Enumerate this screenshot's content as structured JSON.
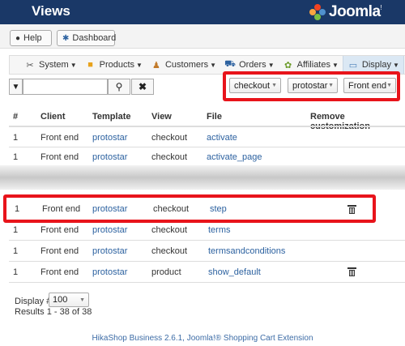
{
  "header": {
    "title": "Views",
    "brand": "Joomla!",
    "brand_word": "Joomla",
    "brand_mark": "!"
  },
  "toolbar": {
    "help_label": "Help",
    "dashboard_label": "Dashboard"
  },
  "menu": {
    "items": [
      {
        "label": "System",
        "icon": "wrench-icon"
      },
      {
        "label": "Products",
        "icon": "box-icon"
      },
      {
        "label": "Customers",
        "icon": "users-icon"
      },
      {
        "label": "Orders",
        "icon": "cart-icon"
      },
      {
        "label": "Affiliates",
        "icon": "affiliates-icon"
      },
      {
        "label": "Display",
        "icon": "display-icon"
      }
    ],
    "active": "Display"
  },
  "filters": {
    "search_value": "",
    "view_select": "checkout",
    "template_select": "protostar",
    "client_select": "Front end"
  },
  "table": {
    "columns": [
      "#",
      "Client",
      "Template",
      "View",
      "File",
      "Remove customization"
    ],
    "rows": [
      {
        "num": "1",
        "client": "Front end",
        "template": "protostar",
        "view": "checkout",
        "file": "activate",
        "removable": false
      },
      {
        "num": "1",
        "client": "Front end",
        "template": "protostar",
        "view": "checkout",
        "file": "activate_page",
        "removable": false
      },
      {
        "num": "1",
        "client": "Front end",
        "template": "protostar",
        "view": "checkout",
        "file": "step",
        "removable": true
      },
      {
        "num": "1",
        "client": "Front end",
        "template": "protostar",
        "view": "checkout",
        "file": "terms",
        "removable": false
      },
      {
        "num": "1",
        "client": "Front end",
        "template": "protostar",
        "view": "checkout",
        "file": "termsandconditions",
        "removable": false
      },
      {
        "num": "1",
        "client": "Front end",
        "template": "protostar",
        "view": "product",
        "file": "show_default",
        "removable": true
      }
    ]
  },
  "pagination": {
    "display_label": "Display #",
    "display_value": "100",
    "results_text": "Results 1 - 38 of 38"
  },
  "footer": {
    "text": "HikaShop Business 2.6.1, Joomla!® Shopping Cart Extension"
  },
  "colors": {
    "topbar": "#1a3867",
    "highlight": "#e8141b",
    "link": "#2d62a0"
  }
}
